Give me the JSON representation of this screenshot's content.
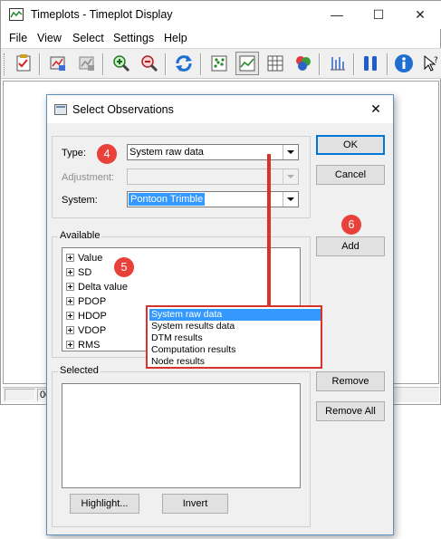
{
  "main_window": {
    "title": "Timeplots - Timeplot Display",
    "controls": {
      "minimize": "—",
      "maximize": "☐",
      "close": "✕"
    },
    "menu": [
      "File",
      "View",
      "Select",
      "Settings",
      "Help"
    ],
    "toolbar_icons": [
      "checklist-icon",
      "plot-options-icon",
      "plot-disabled-icon",
      "zoom-in-icon",
      "zoom-out-icon",
      "refresh-icon",
      "scatter-plot-icon",
      "line-plot-icon",
      "grid-icon",
      "color-balls-icon",
      "bars-icon",
      "pause-icon",
      "info-icon",
      "help-pointer-icon"
    ],
    "statusbar": {
      "pane2": "00"
    }
  },
  "dialog": {
    "title": "Select Observations",
    "close": "✕",
    "type_label": "Type:",
    "type_value": "System raw data",
    "adjustment_label": "Adjustment:",
    "adjustment_value": "",
    "system_label": "System:",
    "system_value": "Pontoon Trimble",
    "ok_label": "OK",
    "cancel_label": "Cancel",
    "add_label": "Add",
    "available_label": "Available",
    "available_items": [
      "Value",
      "SD",
      "Delta value",
      "PDOP",
      "HDOP",
      "VDOP",
      "RMS"
    ],
    "selected_label": "Selected",
    "remove_label": "Remove",
    "remove_all_label": "Remove All",
    "highlight_label": "Highlight...",
    "invert_label": "Invert",
    "type_options": [
      "System raw data",
      "System results data",
      "DTM results",
      "Computation results",
      "Node results"
    ],
    "type_options_highlighted": 0
  },
  "callouts": {
    "c4": "4",
    "c5": "5",
    "c6": "6"
  },
  "colors": {
    "accent": "#3399ff",
    "callout": "#e8413a",
    "arrow": "#d9322c"
  }
}
